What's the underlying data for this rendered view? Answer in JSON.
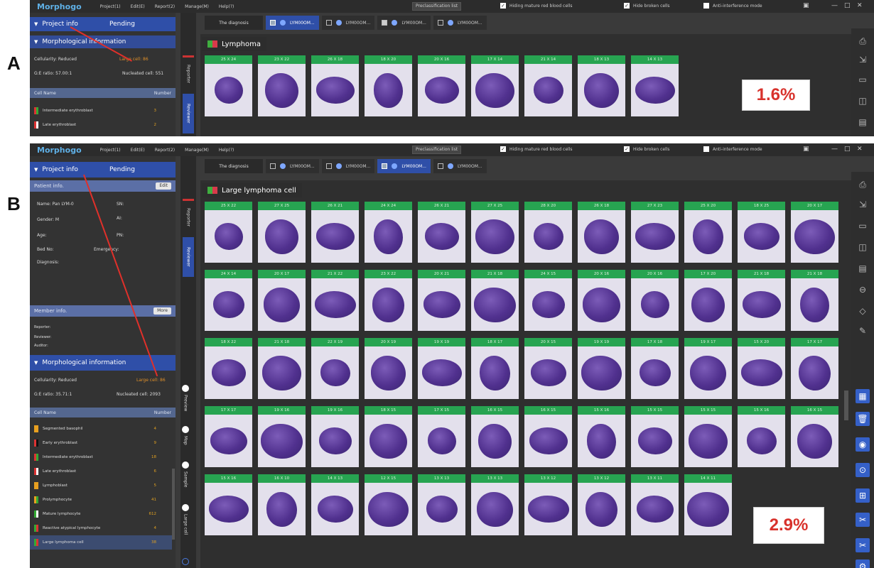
{
  "panel_a": {
    "letter": "A",
    "app_name": "Morphogo",
    "menus": [
      "Project(1)",
      "Edit(E)",
      "Report(2)",
      "Manage(M)",
      "Help(?)"
    ],
    "reclassify": "Preclassification list",
    "checkboxes": [
      {
        "label": "Hiding mature red blood cells",
        "checked": true
      },
      {
        "label": "Hide broken cells",
        "checked": true
      },
      {
        "label": "Anti-interference mode",
        "checked": false
      }
    ],
    "project_info": "Project info",
    "pending": "Pending",
    "morph_info": "Morphological information",
    "cellularity": "Cellularity: Reduced",
    "large_cell": "Large cell: 86",
    "ge_ratio": "G:E ratio: 57.00:1",
    "nucleated": "Nucleated cell: 551",
    "col_name": "Cell Name",
    "col_number": "Number",
    "cells": [
      {
        "name": "Intermediate erythroblast",
        "count": "3",
        "c1": "#d33",
        "c2": "#3a3"
      },
      {
        "name": "Late erythroblast",
        "count": "2",
        "c1": "#d33",
        "c2": "#fff"
      }
    ],
    "side_tabs": [
      "Reporter",
      "Reviewer"
    ],
    "tabs": [
      "The diagnosis",
      "LYM00OM...",
      "LYM00OM...",
      "LYM00OM...",
      "LYM00OM..."
    ],
    "section": "Lymphoma",
    "tile_labels": [
      "25 X 24",
      "23 X 22",
      "26 X 18",
      "18 X 20",
      "20 X 16",
      "17 X 14",
      "21 X 14",
      "18 X 13",
      "14 X 13"
    ],
    "percentage": "1.6%"
  },
  "panel_b": {
    "letter": "B",
    "app_name": "Morphogo",
    "menus": [
      "Project(1)",
      "Edit(E)",
      "Report(2)",
      "Manage(M)",
      "Help(?)"
    ],
    "reclassify": "Preclassification list",
    "checkboxes": [
      {
        "label": "Hiding mature red blood cells",
        "checked": true
      },
      {
        "label": "Hide broken cells",
        "checked": true
      },
      {
        "label": "Anti-interference mode",
        "checked": false
      }
    ],
    "project_info": "Project info",
    "pending": "Pending",
    "patient_info": "Patient info.",
    "edit": "Edit",
    "name": "Name: Pan LYM-0",
    "sn": "SN:",
    "gender": "Gender: M",
    "ai": "AI:",
    "age": "Age:",
    "pn": "PN:",
    "bed": "Bed No:",
    "emergency": "Emergency:",
    "diagnosis": "Diagnosis:",
    "member_info": "Member info.",
    "more": "More",
    "reporter": "Reporter:",
    "reviewer": "Reviewer:",
    "auditor": "Auditor:",
    "morph_info": "Morphological information",
    "cellularity": "Cellularity: Reduced",
    "large_cell": "Large cell: 86",
    "ge_ratio": "G:E ratio: 35.71:1",
    "nucleated": "Nucleated cell: 2093",
    "col_name": "Cell Name",
    "col_number": "Number",
    "cells": [
      {
        "name": "Segmented basophil",
        "count": "4",
        "c1": "#e8a020",
        "c2": "#e8a020"
      },
      {
        "name": "Early erythroblast",
        "count": "9",
        "c1": "#d33",
        "c2": "#111"
      },
      {
        "name": "Intermediate erythroblast",
        "count": "18",
        "c1": "#d33",
        "c2": "#3a3"
      },
      {
        "name": "Late erythroblast",
        "count": "6",
        "c1": "#d33",
        "c2": "#fff"
      },
      {
        "name": "Lymphoblast",
        "count": "5",
        "c1": "#e8a020",
        "c2": "#e8a020"
      },
      {
        "name": "Prolymphocyte",
        "count": "41",
        "c1": "#e8a020",
        "c2": "#3a3"
      },
      {
        "name": "Mature lymphocyte",
        "count": "612",
        "c1": "#3a3",
        "c2": "#fff"
      },
      {
        "name": "Reactive atypical lymphocyte",
        "count": "4",
        "c1": "#3a3",
        "c2": "#d33"
      },
      {
        "name": "Large lymphoma cell",
        "count": "38",
        "c1": "#3a3",
        "c2": "#d33"
      }
    ],
    "side_tabs": [
      "Reporter",
      "Reviewer"
    ],
    "radios": [
      "Preview",
      "Map",
      "Sample",
      "Large cell"
    ],
    "tabs": [
      "The diagnosis",
      "LYM00OM...",
      "LYM00OM...",
      "LYM00OM...",
      "LYM00OM..."
    ],
    "section": "Large lymphoma cell",
    "tile_labels": [
      "25 X 22",
      "27 X 25",
      "26 X 21",
      "24 X 24",
      "26 X 21",
      "27 X 25",
      "28 X 20",
      "26 X 18",
      "27 X 23",
      "25 X 20",
      "18 X 25",
      "20 X 17",
      "24 X 14",
      "20 X 17",
      "21 X 22",
      "23 X 22",
      "20 X 21",
      "21 X 18",
      "24 X 15",
      "20 X 16",
      "20 X 16",
      "17 X 20",
      "21 X 18",
      "21 X 18",
      "18 X 22",
      "21 X 18",
      "22 X 19",
      "20 X 19",
      "19 X 19",
      "18 X 17",
      "20 X 15",
      "19 X 19",
      "17 X 18",
      "19 X 17",
      "15 X 20",
      "17 X 17",
      "17 X 17",
      "19 X 16",
      "19 X 16",
      "18 X 15",
      "17 X 15",
      "16 X 15",
      "16 X 15",
      "15 X 16",
      "15 X 15",
      "15 X 15",
      "15 X 16",
      "16 X 15",
      "15 X 16",
      "16 X 10",
      "14 X 13",
      "12 X 15",
      "13 X 13",
      "13 X 13",
      "13 X 12",
      "13 X 12",
      "13 X 11",
      "14 X 11"
    ],
    "percentage": "2.9%"
  },
  "colors": {
    "accent": "#2f4fa8",
    "tile_header": "#27a451",
    "pct_text": "#d8322c",
    "arrow": "#e0302a"
  }
}
